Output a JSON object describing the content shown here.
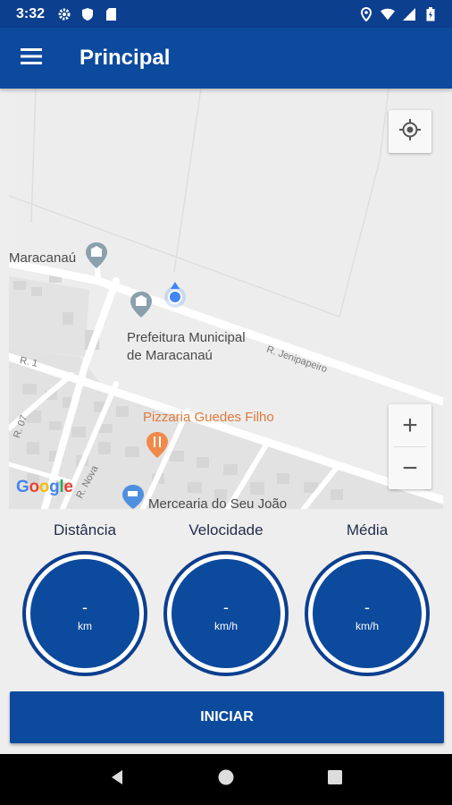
{
  "status_bar": {
    "time": "3:32",
    "icons_left": [
      "gear-icon",
      "shield-icon",
      "sd-card-icon"
    ],
    "icons_right": [
      "location-icon",
      "wifi-icon",
      "signal-icon",
      "battery-icon"
    ]
  },
  "app_bar": {
    "title": "Principal",
    "menu_icon": "hamburger-menu-icon"
  },
  "map": {
    "labels": {
      "maracanau": "Maracanaú",
      "prefeitura": "Prefeitura Municipal\nde Maracanaú",
      "street_jenipapeiro": "R. Jenipapeiro",
      "street_r1": "R. 1",
      "street_r07": "R. 07",
      "street_nova": "R. Nova",
      "pizzaria": "Pizzaria Guedes Filho",
      "mercearia": "Mercearia do Seu João"
    },
    "zoom_in": "+",
    "zoom_out": "−",
    "google": "Google",
    "google_colors": [
      "#4285F4",
      "#EA4335",
      "#FBBC05",
      "#4285F4",
      "#34A853",
      "#EA4335"
    ]
  },
  "stats": [
    {
      "label": "Distância",
      "value": "-",
      "unit": "km"
    },
    {
      "label": "Velocidade",
      "value": "-",
      "unit": "km/h"
    },
    {
      "label": "Média",
      "value": "-",
      "unit": "km/h"
    }
  ],
  "start_button": {
    "label": "INICIAR"
  },
  "colors": {
    "primary": "#0c4a9e",
    "primary_dark": "#0d3f8f",
    "location_dot": "#4285F4",
    "poi_orange": "#e07a3b"
  }
}
